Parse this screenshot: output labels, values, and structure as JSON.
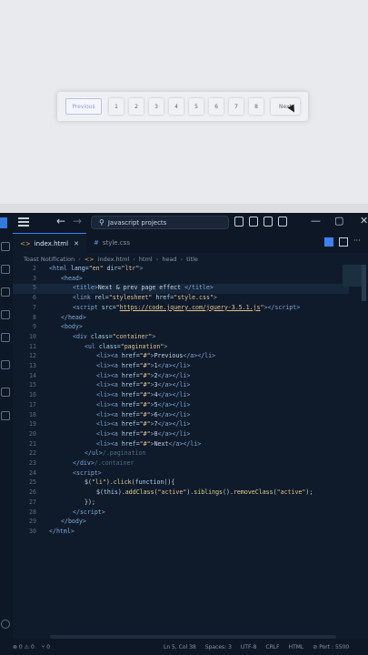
{
  "preview": {
    "pagination": {
      "previous": "Previous",
      "pages": [
        "1",
        "2",
        "3",
        "4",
        "5",
        "6",
        "7",
        "8"
      ],
      "next": "Next",
      "active": "Previous"
    }
  },
  "titlebar": {
    "search": "Javascript projects"
  },
  "tabs": [
    {
      "label": "index.html",
      "close": "✕",
      "active": true
    },
    {
      "label": "style.css",
      "active": false
    }
  ],
  "breadcrumb": {
    "root": "Toast Notification",
    "file": "index.html",
    "items": [
      "html",
      "head",
      "title"
    ]
  },
  "code": {
    "lines": [
      {
        "n": "2",
        "html": "<span class='tag'>&lt;html</span> <span class='attr'>lang=</span><span class='val'>\"en\"</span> <span class='attr'>dir=</span><span class='val'>\"ltr\"</span><span class='tag'>&gt;</span>",
        "indent": 0
      },
      {
        "n": "3",
        "html": "<span class='tag'>&lt;head&gt;</span>",
        "indent": 1
      },
      {
        "n": "5",
        "html": "<span class='tag'>&lt;title&gt;</span><span class='plain'>Next &amp; prev page effect </span><span class='tag'>&lt;/title&gt;</span>",
        "indent": 2,
        "cur": true
      },
      {
        "n": "6",
        "html": "<span class='tag'>&lt;link</span> <span class='attr'>rel=</span><span class='val'>\"stylesheet\"</span> <span class='attr'>href=</span><span class='val'>\"style.css\"</span><span class='tag'>&gt;</span>",
        "indent": 2
      },
      {
        "n": "7",
        "html": "<span class='tag'>&lt;script</span> <span class='attr'>src=</span><span class='val'>\"</span><span class='link'>https://code.jquery.com/jquery-3.5.1.js</span><span class='val'>\"</span><span class='tag'>&gt;&lt;/script&gt;</span>",
        "indent": 2
      },
      {
        "n": "8",
        "html": "<span class='tag'>&lt;/head&gt;</span>",
        "indent": 1
      },
      {
        "n": "9",
        "html": "<span class='tag'>&lt;body&gt;</span>",
        "indent": 1
      },
      {
        "n": "10",
        "html": "<span class='tag'>&lt;div</span> <span class='attr'>class=</span><span class='val'>\"container\"</span><span class='tag'>&gt;</span>",
        "indent": 2
      },
      {
        "n": "11",
        "html": "<span class='tag'>&lt;ul</span> <span class='attr'>class=</span><span class='val'>\"pagination\"</span><span class='tag'>&gt;</span>",
        "indent": 3
      },
      {
        "n": "12",
        "html": "<span class='tag'>&lt;li&gt;&lt;a</span> <span class='attr'>href=</span><span class='val'>\"#\"</span><span class='tag'>&gt;</span><span class='plain'>Previous</span><span class='tag'>&lt;/a&gt;&lt;/li&gt;</span>",
        "indent": 4
      },
      {
        "n": "13",
        "html": "<span class='tag'>&lt;li&gt;&lt;a</span> <span class='attr'>href=</span><span class='val'>\"#\"</span><span class='tag'>&gt;</span><span class='plain'>1</span><span class='tag'>&lt;/a&gt;&lt;/li&gt;</span>",
        "indent": 4
      },
      {
        "n": "14",
        "html": "<span class='tag'>&lt;li&gt;&lt;a</span> <span class='attr'>href=</span><span class='val'>\"#\"</span><span class='tag'>&gt;</span><span class='plain'>2</span><span class='tag'>&lt;/a&gt;&lt;/li&gt;</span>",
        "indent": 4
      },
      {
        "n": "15",
        "html": "<span class='tag'>&lt;li&gt;&lt;a</span> <span class='attr'>href=</span><span class='val'>\"#\"</span><span class='tag'>&gt;</span><span class='plain'>3</span><span class='tag'>&lt;/a&gt;&lt;/li&gt;</span>",
        "indent": 4
      },
      {
        "n": "16",
        "html": "<span class='tag'>&lt;li&gt;&lt;a</span> <span class='attr'>href=</span><span class='val'>\"#\"</span><span class='tag'>&gt;</span><span class='plain'>4</span><span class='tag'>&lt;/a&gt;&lt;/li&gt;</span>",
        "indent": 4
      },
      {
        "n": "17",
        "html": "<span class='tag'>&lt;li&gt;&lt;a</span> <span class='attr'>href=</span><span class='val'>\"#\"</span><span class='tag'>&gt;</span><span class='plain'>5</span><span class='tag'>&lt;/a&gt;&lt;/li&gt;</span>",
        "indent": 4
      },
      {
        "n": "18",
        "html": "<span class='tag'>&lt;li&gt;&lt;a</span> <span class='attr'>href=</span><span class='val'>\"#\"</span><span class='tag'>&gt;</span><span class='plain'>6</span><span class='tag'>&lt;/a&gt;&lt;/li&gt;</span>",
        "indent": 4
      },
      {
        "n": "19",
        "html": "<span class='tag'>&lt;li&gt;&lt;a</span> <span class='attr'>href=</span><span class='val'>\"#\"</span><span class='tag'>&gt;</span><span class='plain'>7</span><span class='tag'>&lt;/a&gt;&lt;/li&gt;</span>",
        "indent": 4
      },
      {
        "n": "20",
        "html": "<span class='tag'>&lt;li&gt;&lt;a</span> <span class='attr'>href=</span><span class='val'>\"#\"</span><span class='tag'>&gt;</span><span class='plain'>8</span><span class='tag'>&lt;/a&gt;&lt;/li&gt;</span>",
        "indent": 4
      },
      {
        "n": "21",
        "html": "<span class='tag'>&lt;li&gt;&lt;a</span> <span class='attr'>href=</span><span class='val'>\"#\"</span><span class='tag'>&gt;</span><span class='plain'>Next</span><span class='tag'>&lt;/a&gt;&lt;/li&gt;</span>",
        "indent": 4
      },
      {
        "n": "22",
        "html": "<span class='tag'>&lt;/ul&gt;</span><span class='cmt'>/.pagination</span>",
        "indent": 3
      },
      {
        "n": "23",
        "html": "<span class='tag'>&lt;/div&gt;</span><span class='cmt'>/.container</span>",
        "indent": 2
      },
      {
        "n": "24",
        "html": "<span class='tag'>&lt;script&gt;</span>",
        "indent": 2
      },
      {
        "n": "25",
        "html": "<span class='plain'>$(</span><span class='val'>\"li\"</span><span class='plain'>).</span><span class='fn'>click</span><span class='plain'>(</span><span class='attr'>function</span><span class='plain'>(){</span>",
        "indent": 3
      },
      {
        "n": "26",
        "html": "<span class='plain'>$(</span><span class='attr'>this</span><span class='plain'>).</span><span class='fn'>addClass</span><span class='plain'>(</span><span class='val'>\"active\"</span><span class='plain'>).</span><span class='fn'>siblings</span><span class='plain'>().</span><span class='fn'>removeClass</span><span class='plain'>(</span><span class='val'>\"active\"</span><span class='plain'>);</span>",
        "indent": 4
      },
      {
        "n": "27",
        "html": "<span class='plain'>});</span>",
        "indent": 3
      },
      {
        "n": "28",
        "html": "<span class='tag'>&lt;/script&gt;</span>",
        "indent": 2
      },
      {
        "n": "29",
        "html": "<span class='tag'>&lt;/body&gt;</span>",
        "indent": 1
      },
      {
        "n": "30",
        "html": "<span class='tag'>&lt;/html&gt;</span>",
        "indent": 0
      }
    ]
  },
  "statusbar": {
    "errors": "⊗ 0 ⚠ 0",
    "ports": "⑂ 0",
    "position": "Ln 5, Col 38",
    "spaces": "Spaces: 3",
    "encoding": "UTF-8",
    "eol": "CRLF",
    "language": "HTML",
    "port": "⊘ Port : 5500"
  }
}
